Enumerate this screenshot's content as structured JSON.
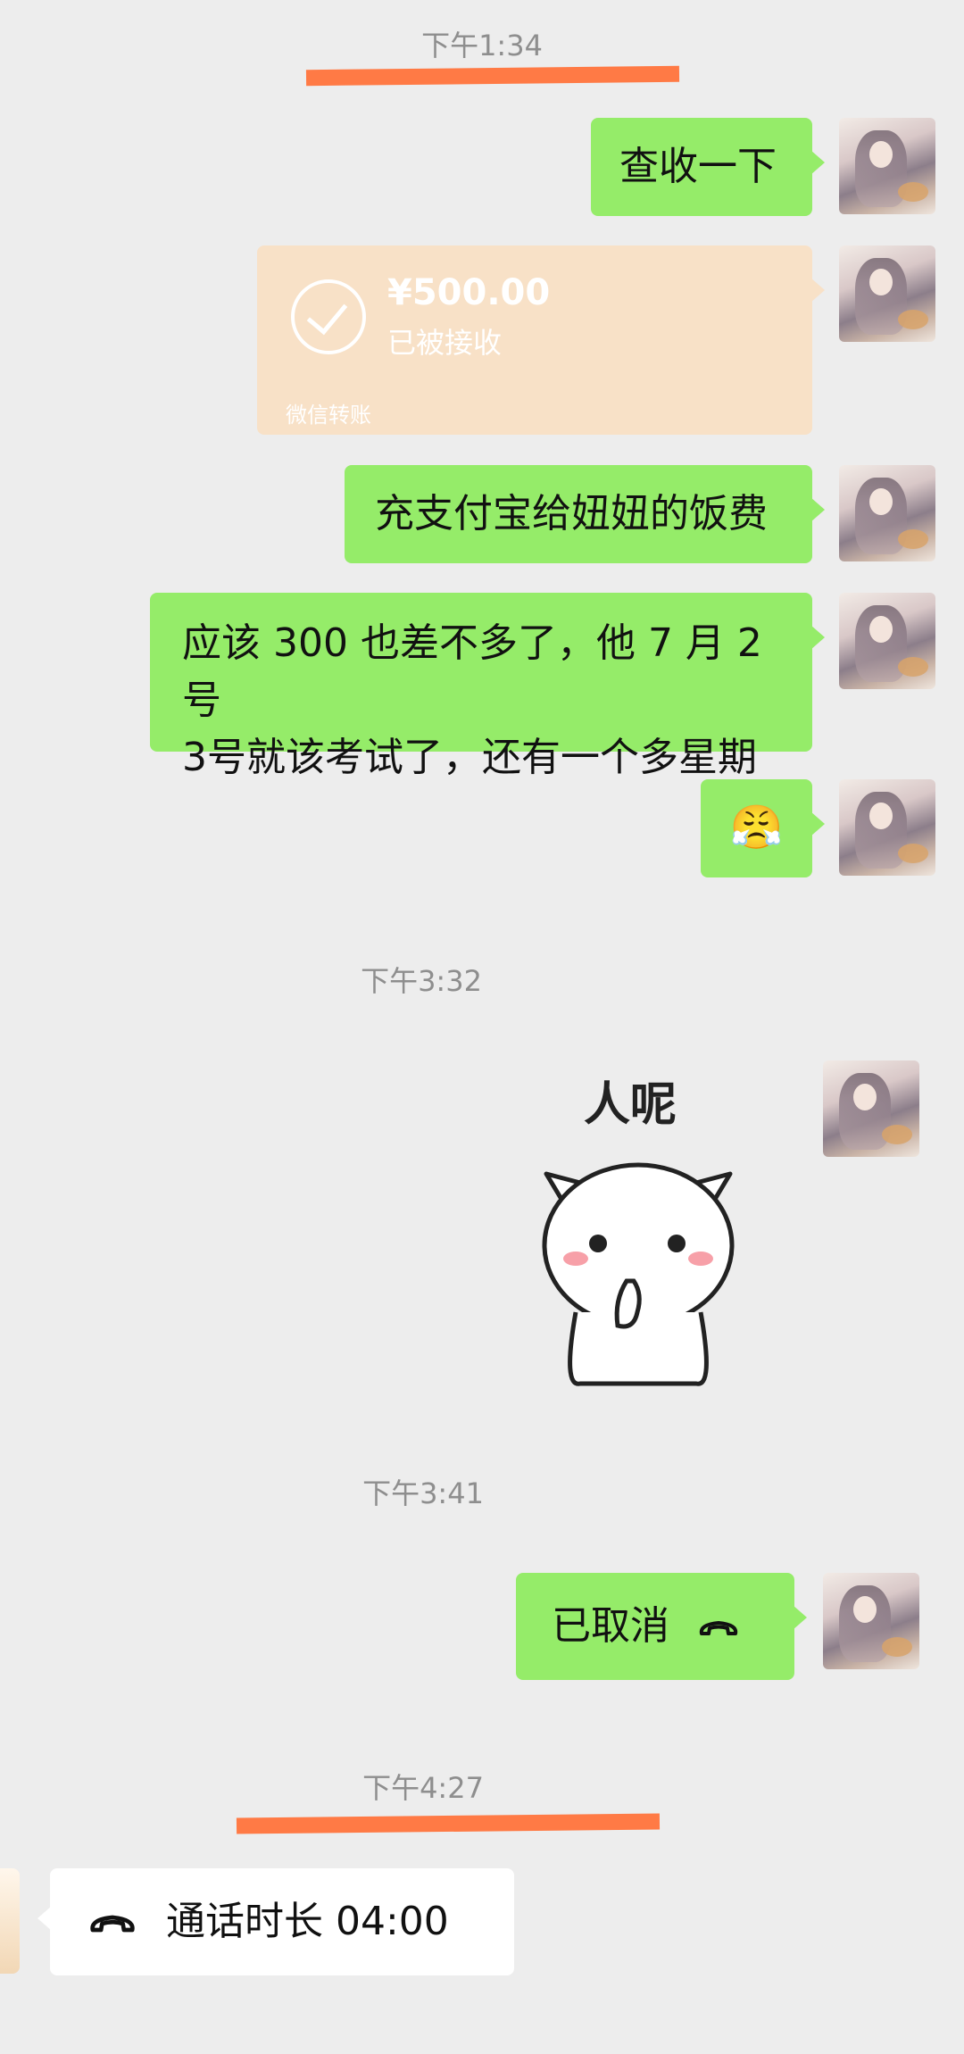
{
  "timestamps": {
    "t1": "下午1:34",
    "t2": "下午3:32",
    "t3": "下午3:41",
    "t4": "下午4:27"
  },
  "messages": {
    "m1": "查收一下",
    "transfer": {
      "amount": "¥500.00",
      "status": "已被接收",
      "label": "微信转账"
    },
    "m2": "充支付宝给妞妞的饭费",
    "m3_line1": "应该 300 也差不多了，他 7 月 2 号",
    "m3_line2": "3号就该考试了，还有一个多星期",
    "m4_emoji": "😤",
    "sticker_text": "人呢",
    "cancelled": "已取消",
    "call_duration": "通话时长 04:00"
  },
  "colors": {
    "background": "#ededed",
    "sent_bubble": "#95ec69",
    "received_bubble": "#ffffff",
    "transfer_card": "#f8e1c7",
    "annotation_mark": "#ff7a45"
  }
}
